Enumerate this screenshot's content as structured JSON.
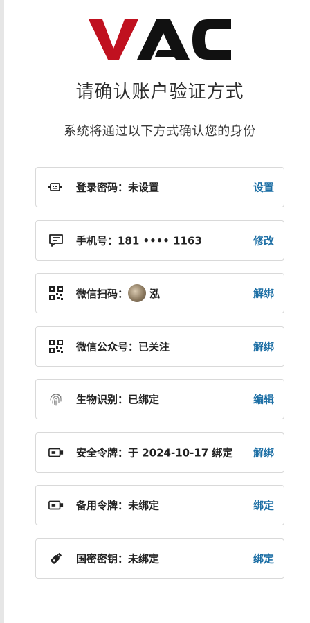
{
  "brand": {
    "logo_text": "VAC",
    "colors": {
      "red": "#c0111f",
      "black": "#111111"
    }
  },
  "header": {
    "title": "请确认账户验证方式",
    "subtitle": "系统将通过以下方式确认您的身份"
  },
  "methods": [
    {
      "icon": "password-keypad-icon",
      "label": "登录密码：未设置",
      "action": "设置"
    },
    {
      "icon": "sms-message-icon",
      "label": "手机号：181 •••• 1163",
      "action": "修改"
    },
    {
      "icon": "qrcode-icon",
      "label": "微信扫码：",
      "nickname": "泓",
      "action": "解绑"
    },
    {
      "icon": "qrcode-icon",
      "label": "微信公众号：已关注",
      "action": "解绑"
    },
    {
      "icon": "fingerprint-icon",
      "label": "生物识别：已绑定",
      "action": "编辑"
    },
    {
      "icon": "security-token-icon",
      "label": "安全令牌：于 2024-10-17 绑定",
      "action": "解绑"
    },
    {
      "icon": "security-token-icon",
      "label": "备用令牌：未绑定",
      "action": "绑定"
    },
    {
      "icon": "usb-key-icon",
      "label": "国密密钥：未绑定",
      "action": "绑定"
    }
  ],
  "colors": {
    "action_link": "#1d6fa5",
    "border": "#d9d9d9"
  }
}
